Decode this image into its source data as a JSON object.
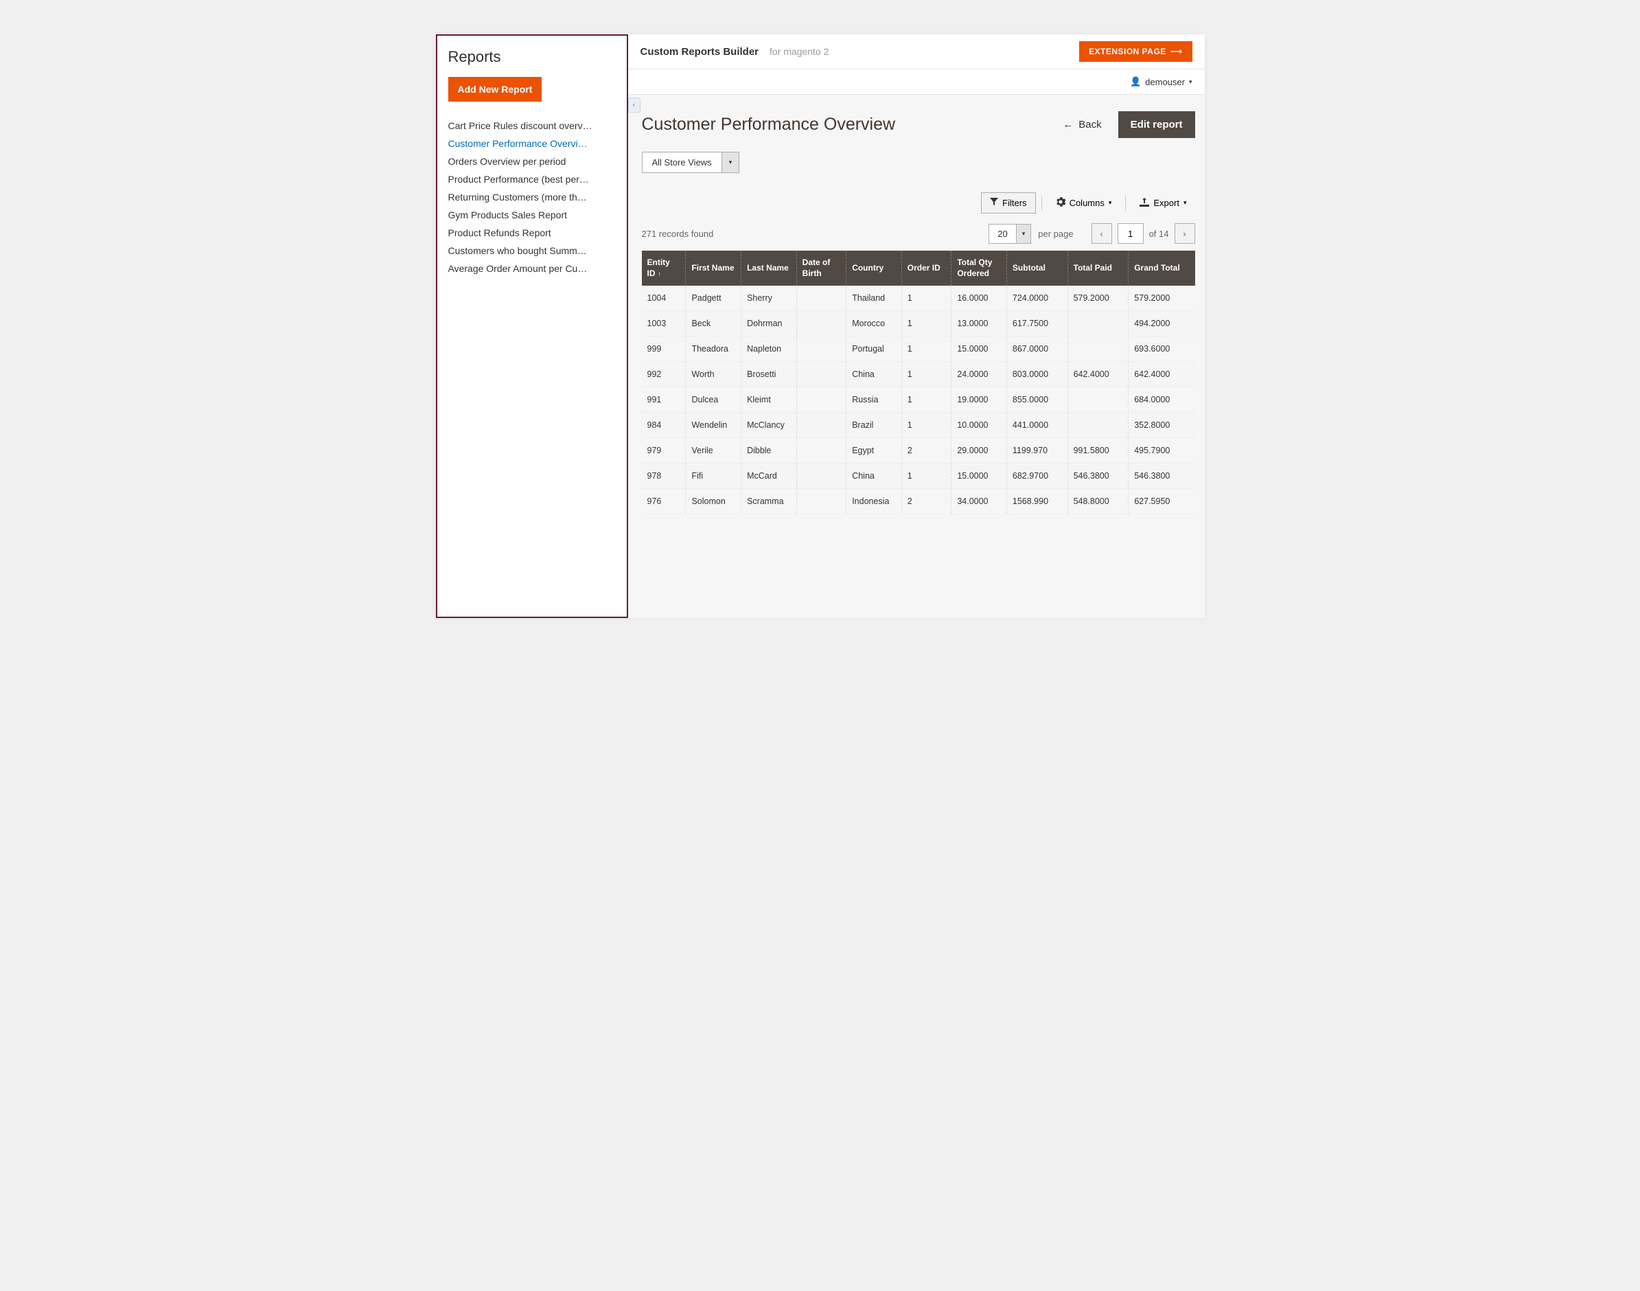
{
  "sidebar": {
    "title": "Reports",
    "add_button": "Add New Report",
    "items": [
      "Cart Price Rules discount overv…",
      "Customer Performance Overvi…",
      "Orders Overview per period",
      "Product Performance (best per…",
      "Returning Customers (more th…",
      "Gym Products Sales Report",
      "Product Refunds Report",
      "Customers who bought Summ…",
      "Average Order Amount per Cu…"
    ],
    "active_index": 1
  },
  "header": {
    "brand": "Custom Reports Builder",
    "brand_sub": "for magento 2",
    "extension_btn": "EXTENSION PAGE",
    "user": "demouser"
  },
  "page": {
    "title": "Customer Performance Overview",
    "back": "Back",
    "edit": "Edit report",
    "store_view": "All Store Views"
  },
  "toolbar": {
    "filters": "Filters",
    "columns": "Columns",
    "export": "Export"
  },
  "grid": {
    "records_found": "271 records found",
    "page_size": "20",
    "per_page": "per page",
    "current_page": "1",
    "of_label": "of 14",
    "columns": [
      "Entity ID",
      "First Name",
      "Last Name",
      "Date of Birth",
      "Country",
      "Order ID",
      "Total Qty Ordered",
      "Subtotal",
      "Total Paid",
      "Grand Total"
    ],
    "sort_col": 0,
    "rows": [
      [
        "1004",
        "Padgett",
        "Sherry",
        "",
        "Thailand",
        "1",
        "16.0000",
        "724.0000",
        "579.2000",
        "579.2000"
      ],
      [
        "1003",
        "Beck",
        "Dohrman",
        "",
        "Morocco",
        "1",
        "13.0000",
        "617.7500",
        "",
        "494.2000"
      ],
      [
        "999",
        "Theadora",
        "Napleton",
        "",
        "Portugal",
        "1",
        "15.0000",
        "867.0000",
        "",
        "693.6000"
      ],
      [
        "992",
        "Worth",
        "Brosetti",
        "",
        "China",
        "1",
        "24.0000",
        "803.0000",
        "642.4000",
        "642.4000"
      ],
      [
        "991",
        "Dulcea",
        "Kleimt",
        "",
        "Russia",
        "1",
        "19.0000",
        "855.0000",
        "",
        "684.0000"
      ],
      [
        "984",
        "Wendelin",
        "McClancy",
        "",
        "Brazil",
        "1",
        "10.0000",
        "441.0000",
        "",
        "352.8000"
      ],
      [
        "979",
        "Verile",
        "Dibble",
        "",
        "Egypt",
        "2",
        "29.0000",
        "1199.970",
        "991.5800",
        "495.7900"
      ],
      [
        "978",
        "Fifi",
        "McCard",
        "",
        "China",
        "1",
        "15.0000",
        "682.9700",
        "546.3800",
        "546.3800"
      ],
      [
        "976",
        "Solomon",
        "Scramma",
        "",
        "Indonesia",
        "2",
        "34.0000",
        "1568.990",
        "548.8000",
        "627.5950"
      ]
    ]
  }
}
